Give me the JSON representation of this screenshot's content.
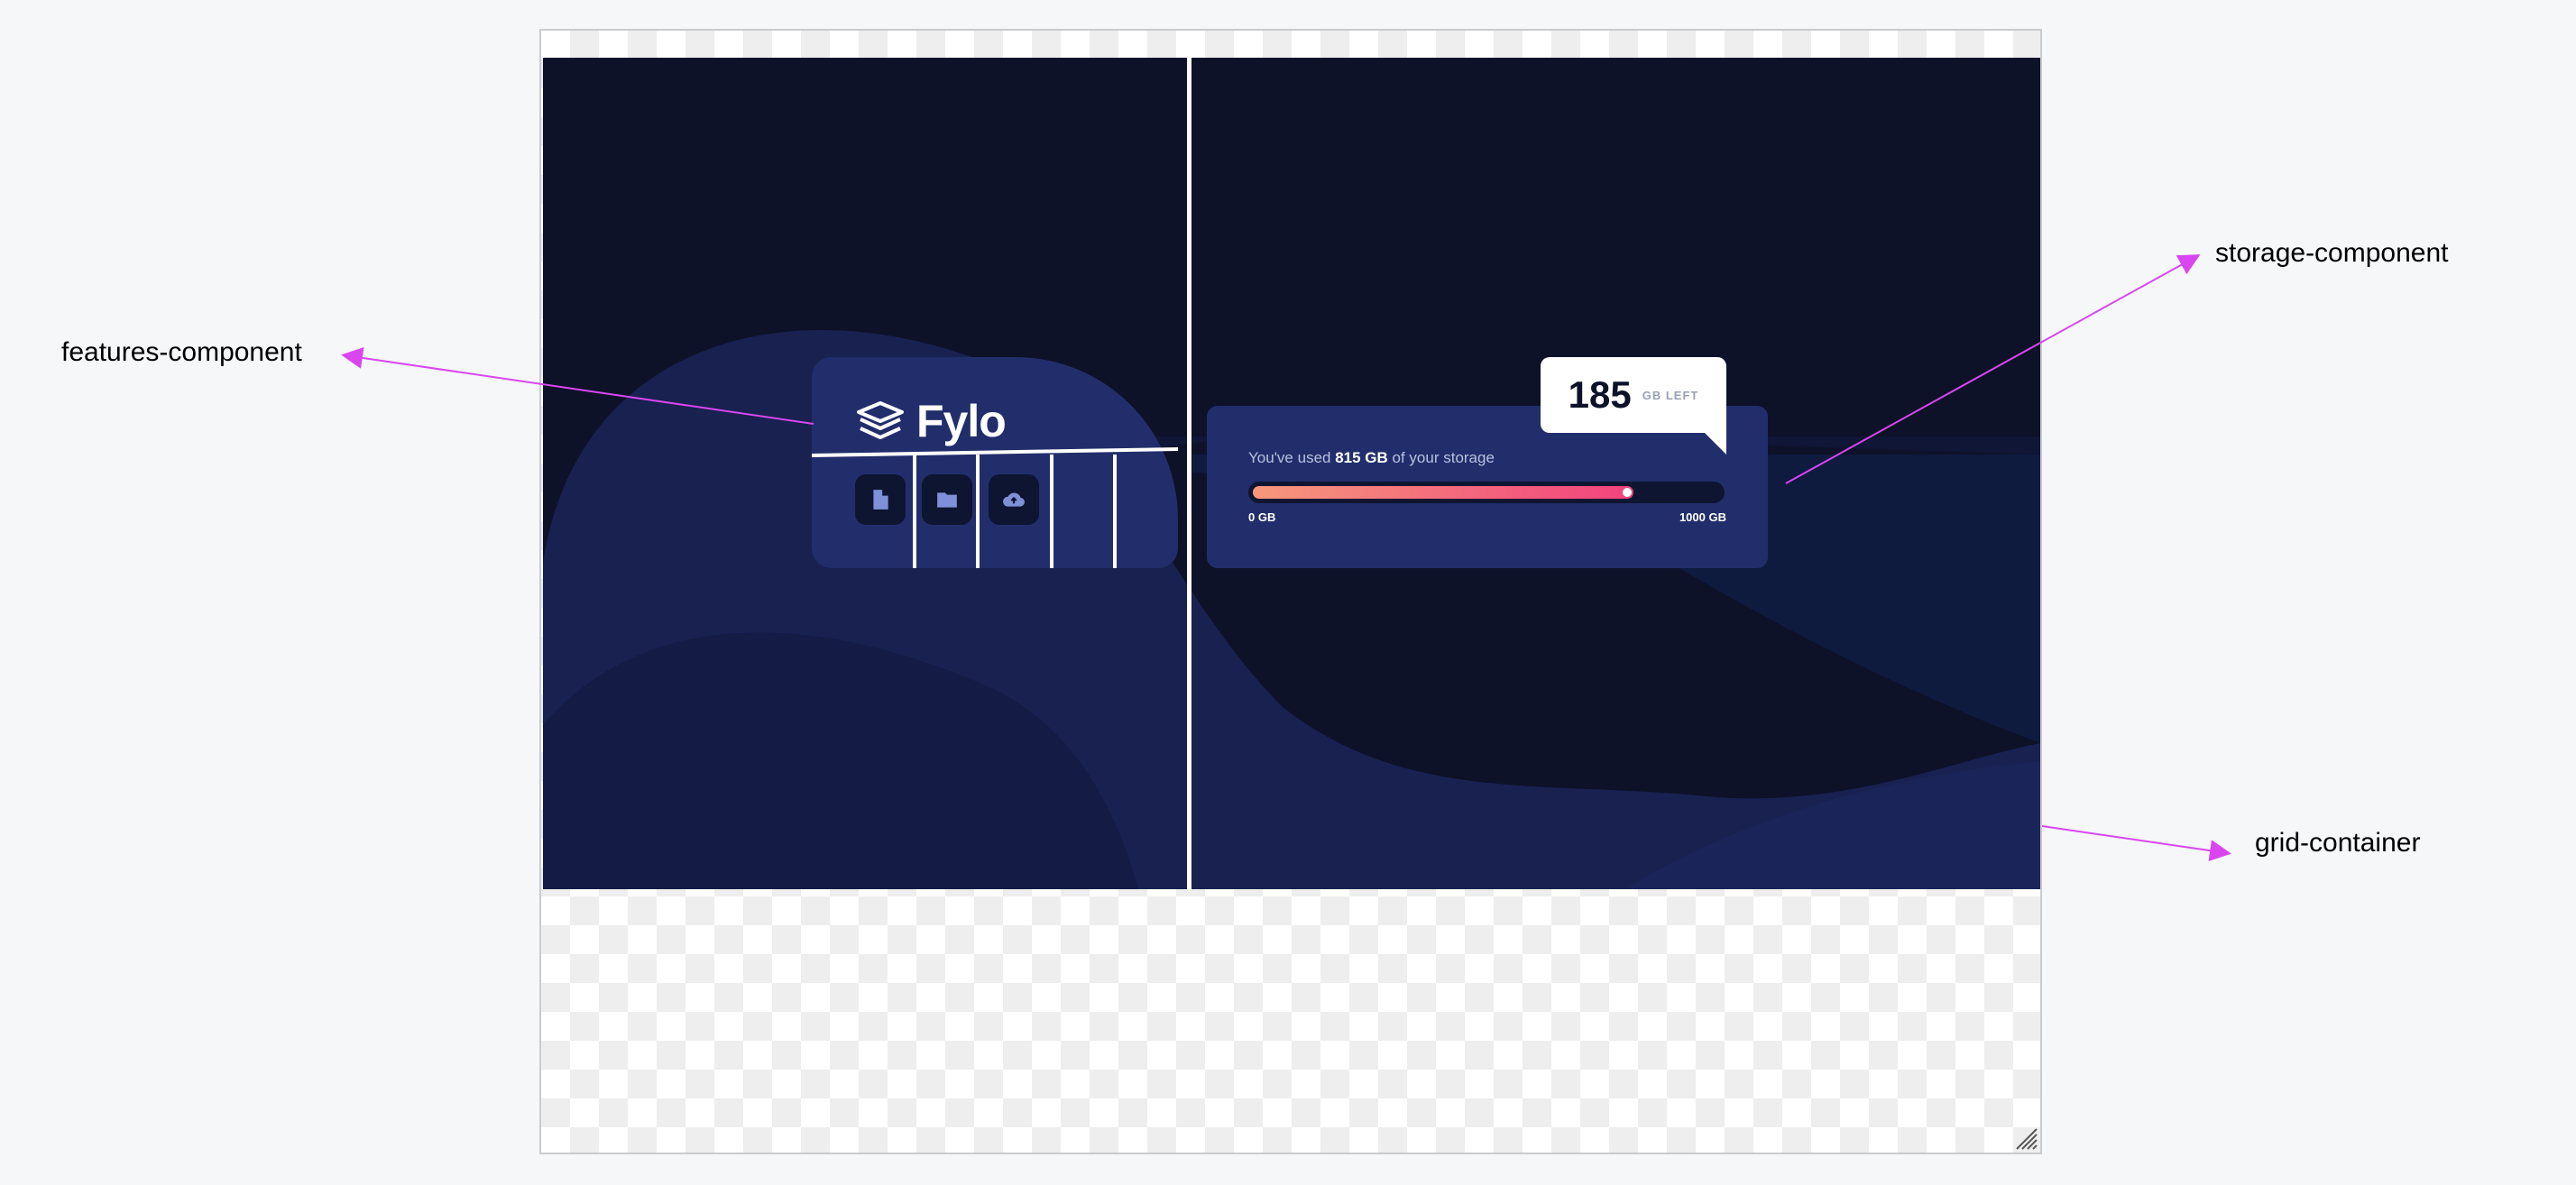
{
  "colors": {
    "page_bg": "#f6f7f9",
    "canvas_bg": "#0d1229",
    "card_bg": "#222e6b",
    "icon_tile_bg": "#0e1531",
    "icon_fill": "#7f90d8",
    "bar_gradient_start": "#f6987b",
    "bar_gradient_end": "#f2427e",
    "annotation_arrow": "#d946ef"
  },
  "features": {
    "logo_text": "Fylo",
    "logo_icon": "layers-icon",
    "buttons": [
      {
        "icon": "document-icon"
      },
      {
        "icon": "folder-icon"
      },
      {
        "icon": "cloud-upload-icon"
      }
    ]
  },
  "storage": {
    "used_prefix": "You've used ",
    "used_value": "815 GB",
    "used_suffix": " of your storage",
    "used_fraction": 0.815,
    "min_label": "0 GB",
    "max_label": "1000 GB",
    "left_value": "185",
    "left_unit": "GB LEFT"
  },
  "annotations": {
    "features": "features-component",
    "storage": "storage-component",
    "grid": "grid-container"
  }
}
